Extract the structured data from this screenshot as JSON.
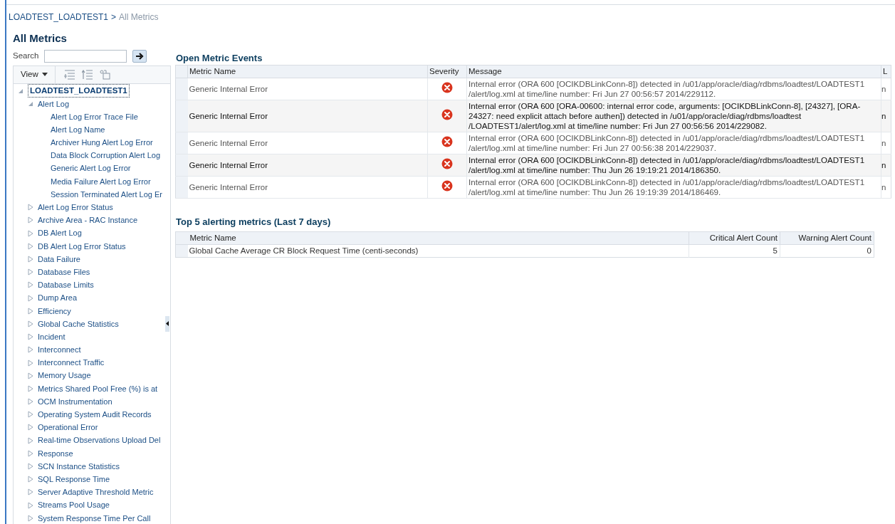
{
  "breadcrumb": {
    "link": "LOADTEST_LOADTEST1",
    "separator": ">",
    "current": "All Metrics"
  },
  "title": "All Metrics",
  "search": {
    "label": "Search"
  },
  "view_menu": "View",
  "tree": [
    {
      "label": "LOADTEST_LOADTEST1",
      "selected": true,
      "expanded": true,
      "children": [
        {
          "label": "Alert Log",
          "selected": false,
          "expanded": true,
          "children": [
            {
              "label": "Alert Log Error Trace File",
              "selected": false
            },
            {
              "label": "Alert Log Name",
              "selected": false
            },
            {
              "label": "Archiver Hung Alert Log Error",
              "selected": false
            },
            {
              "label": "Data Block Corruption Alert Log",
              "selected": false
            },
            {
              "label": "Generic Alert Log Error",
              "selected": false
            },
            {
              "label": "Media Failure Alert Log Error",
              "selected": false
            },
            {
              "label": "Session Terminated Alert Log Er",
              "selected": false
            }
          ]
        },
        {
          "label": "Alert Log Error Status",
          "selected": false,
          "expanded": false
        },
        {
          "label": "Archive Area - RAC Instance",
          "selected": false,
          "expanded": false
        },
        {
          "label": "DB Alert Log",
          "selected": false,
          "expanded": false
        },
        {
          "label": "DB Alert Log Error Status",
          "selected": false,
          "expanded": false
        },
        {
          "label": "Data Failure",
          "selected": false,
          "expanded": false
        },
        {
          "label": "Database Files",
          "selected": false,
          "expanded": false
        },
        {
          "label": "Database Limits",
          "selected": false,
          "expanded": false
        },
        {
          "label": "Dump Area",
          "selected": false,
          "expanded": false
        },
        {
          "label": "Efficiency",
          "selected": false,
          "expanded": false
        },
        {
          "label": "Global Cache Statistics",
          "selected": false,
          "expanded": false
        },
        {
          "label": "Incident",
          "selected": false,
          "expanded": false
        },
        {
          "label": "Interconnect",
          "selected": false,
          "expanded": false
        },
        {
          "label": "Interconnect Traffic",
          "selected": false,
          "expanded": false
        },
        {
          "label": "Memory Usage",
          "selected": false,
          "expanded": false
        },
        {
          "label": "Metrics Shared Pool Free (%) is at",
          "selected": false,
          "expanded": false
        },
        {
          "label": "OCM Instrumentation",
          "selected": false,
          "expanded": false
        },
        {
          "label": "Operating System Audit Records",
          "selected": false,
          "expanded": false
        },
        {
          "label": "Operational Error",
          "selected": false,
          "expanded": false
        },
        {
          "label": "Real-time Observations Upload Del",
          "selected": false,
          "expanded": false
        },
        {
          "label": "Response",
          "selected": false,
          "expanded": false
        },
        {
          "label": "SCN Instance Statistics",
          "selected": false,
          "expanded": false
        },
        {
          "label": "SQL Response Time",
          "selected": false,
          "expanded": false
        },
        {
          "label": "Server Adaptive Threshold Metric",
          "selected": false,
          "expanded": false
        },
        {
          "label": "Streams Pool Usage",
          "selected": false,
          "expanded": false
        },
        {
          "label": "System Response Time Per Call",
          "selected": false,
          "expanded": false
        }
      ]
    }
  ],
  "open_events": {
    "title": "Open Metric Events",
    "columns": [
      "Metric Name",
      "Severity",
      "Message",
      "L"
    ],
    "rows": [
      {
        "metric": "Generic Internal Error",
        "message": "Internal error (ORA 600 [OCIKDBLinkConn-8]) detected in /u01/app/oracle/diag/rdbms/loadtest/LOADTEST1 /alert/log.xml at time/line number: Fri Jun 27 00:56:57 2014/229112.",
        "column_4": "n"
      },
      {
        "metric": "Generic Internal Error",
        "message": "Internal error (ORA 600 [ORA-00600: internal error code, arguments: [OCIKDBLinkConn-8], [24327], [ORA-24327: need explicit attach before authen]) detected in /u01/app/oracle/diag/rdbms/loadtest /LOADTEST1/alert/log.xml at time/line number: Fri Jun 27 00:56:56 2014/229082.",
        "column_4": "n"
      },
      {
        "metric": "Generic Internal Error",
        "message": "Internal error (ORA 600 [OCIKDBLinkConn-8]) detected in /u01/app/oracle/diag/rdbms/loadtest/LOADTEST1 /alert/log.xml at time/line number: Fri Jun 27 00:56:38 2014/229037.",
        "column_4": "n"
      },
      {
        "metric": "Generic Internal Error",
        "message": "Internal error (ORA 600 [OCIKDBLinkConn-8]) detected in /u01/app/oracle/diag/rdbms/loadtest/LOADTEST1 /alert/log.xml at time/line number: Thu Jun 26 19:19:21 2014/186350.",
        "column_4": "n"
      },
      {
        "metric": "Generic Internal Error",
        "message": "Internal error (ORA 600 [OCIKDBLinkConn-8]) detected in /u01/app/oracle/diag/rdbms/loadtest/LOADTEST1 /alert/log.xml at time/line number: Thu Jun 26 19:19:39 2014/186469.",
        "column_4": "n"
      }
    ]
  },
  "top_metrics": {
    "title": "Top 5 alerting metrics (Last 7 days)",
    "columns": [
      "Metric Name",
      "Critical Alert Count",
      "Warning Alert Count"
    ],
    "rows": [
      {
        "metric": "Global Cache Average CR Block Request Time (centi-seconds)",
        "critical": "5",
        "warning": "0"
      }
    ]
  }
}
